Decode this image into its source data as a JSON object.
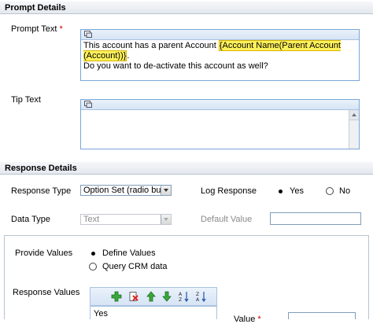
{
  "prompt_details": {
    "header": "Prompt Details",
    "prompt_text_label": "Prompt Text",
    "required_marker": "*",
    "prompt_text_line1_before": "This account has a parent Account ",
    "prompt_text_field_token": "{Account Name(Parent Account (Account))}",
    "prompt_text_line1_after": ".",
    "prompt_text_line2": "Do you want to de-activate this account as well?",
    "tip_text_label": "Tip Text"
  },
  "response_details": {
    "header": "Response Details",
    "response_type_label": "Response Type",
    "response_type_value": "Option Set (radio but",
    "log_response_label": "Log Response",
    "log_yes": "Yes",
    "log_no": "No",
    "log_selected": "Yes",
    "data_type_label": "Data Type",
    "data_type_value": "Text",
    "default_value_label": "Default Value"
  },
  "values_panel": {
    "provide_values_label": "Provide Values",
    "define_values": "Define Values",
    "query_crm_data": "Query CRM data",
    "selected": "Define Values",
    "response_values_label": "Response Values",
    "list_first_item": "Yes",
    "value_label": "Value",
    "required_marker": "*"
  },
  "colors": {
    "accent_border": "#7aa7d6",
    "highlight": "#fff15a",
    "required": "#cc0000"
  }
}
